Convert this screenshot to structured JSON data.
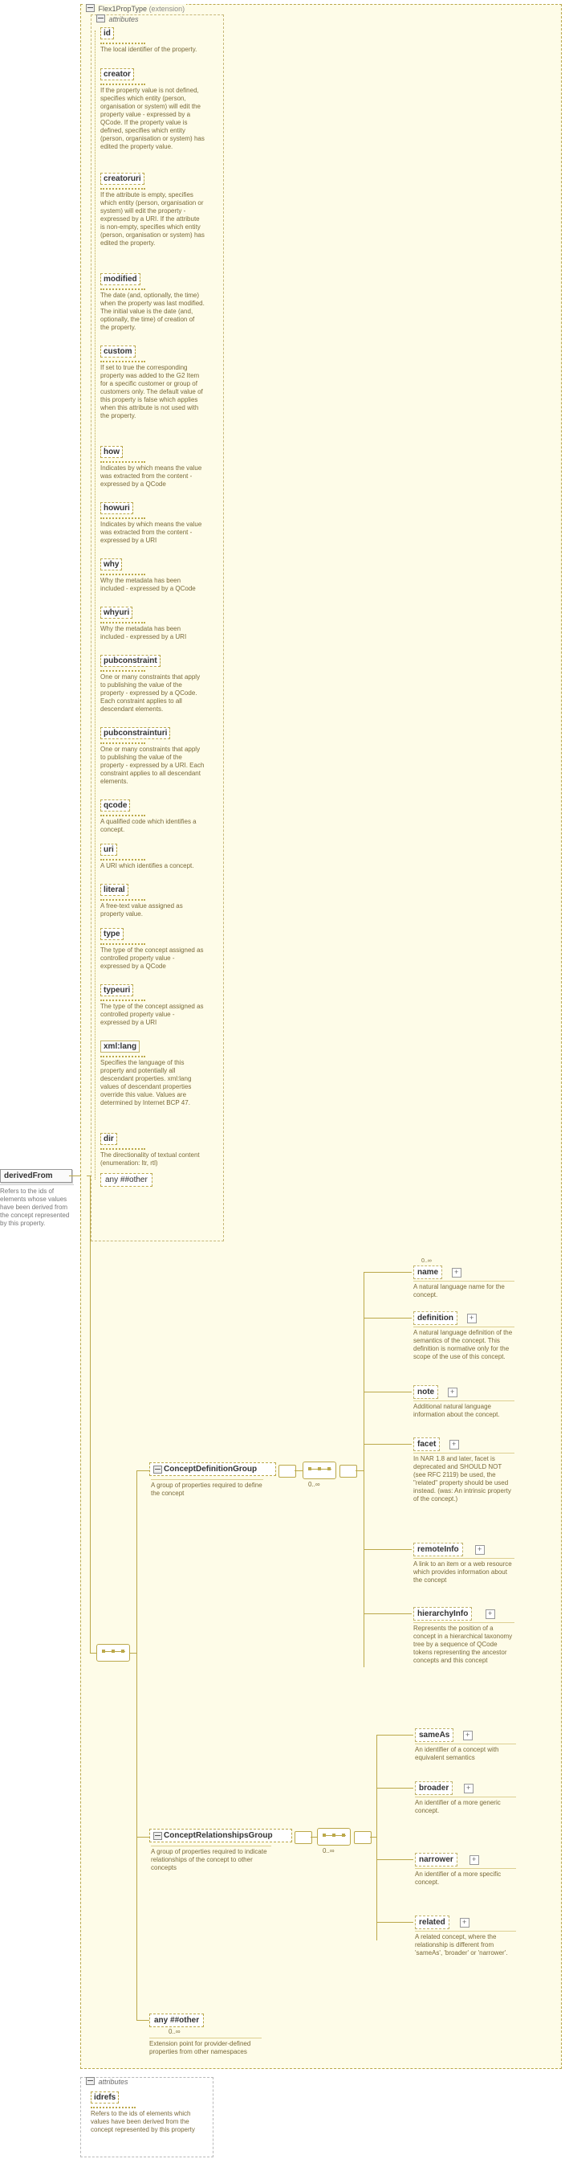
{
  "root": {
    "name": "derivedFrom",
    "desc": "Refers to the ids of elements whose values have been derived from the concept represented by this property."
  },
  "top_panel": {
    "label_type": "Flex1PropType",
    "label_ext": "(extension)"
  },
  "attr_group_top": {
    "label": "attributes",
    "items": [
      {
        "name": "id",
        "desc": "The local identifier of the property."
      },
      {
        "name": "creator",
        "desc": "If the property value is not defined, specifies which entity (person, organisation or system) will edit the property value - expressed by a QCode. If the property value is defined, specifies which entity (person, organisation or system) has edited the property value."
      },
      {
        "name": "creatoruri",
        "desc": "If the attribute is empty, specifies which entity (person, organisation or system) will edit the property - expressed by a URI. If the attribute is non-empty, specifies which entity (person, organisation or system) has edited the property."
      },
      {
        "name": "modified",
        "desc": "The date (and, optionally, the time) when the property was last modified. The initial value is the date (and, optionally, the time) of creation of the property."
      },
      {
        "name": "custom",
        "desc": "If set to true the corresponding property was added to the G2 Item for a specific customer or group of customers only. The default value of this property is false which applies when this attribute is not used with the property."
      },
      {
        "name": "how",
        "desc": "Indicates by which means the value was extracted from the content - expressed by a QCode"
      },
      {
        "name": "howuri",
        "desc": "Indicates by which means the value was extracted from the content - expressed by a URI"
      },
      {
        "name": "why",
        "desc": "Why the metadata has been included - expressed by a QCode"
      },
      {
        "name": "whyuri",
        "desc": "Why the metadata has been included - expressed by a URI"
      },
      {
        "name": "pubconstraint",
        "desc": "One or many constraints that apply to publishing the value of the property - expressed by a QCode. Each constraint applies to all descendant elements."
      },
      {
        "name": "pubconstrainturi",
        "desc": "One or many constraints that apply to publishing the value of the property - expressed by a URI. Each constraint applies to all descendant elements."
      },
      {
        "name": "qcode",
        "desc": "A qualified code which identifies a concept."
      },
      {
        "name": "uri",
        "desc": "A URI which identifies a concept."
      },
      {
        "name": "literal",
        "desc": "A free-text value assigned as property value."
      },
      {
        "name": "type",
        "desc": "The type of the concept assigned as controlled property value - expressed by a QCode"
      },
      {
        "name": "typeuri",
        "desc": "The type of the concept assigned as controlled property value - expressed by a URI"
      },
      {
        "name": "xml:lang",
        "desc": "Specifies the language of this property and potentially all descendant properties. xml:lang values of descendant properties override this value. Values are determined by Internet BCP 47."
      },
      {
        "name": "dir",
        "desc": "The directionality of textual content (enumeration: ltr, rtl)"
      }
    ],
    "any_other": "any ##other"
  },
  "groups": {
    "def": {
      "label": "ConceptDefinitionGroup",
      "desc": "A group of properties required to define the concept"
    },
    "rel": {
      "label": "ConceptRelationshipsGroup",
      "desc": "A group of properties required to indicate relationships of the concept to other concepts"
    }
  },
  "def_children": {
    "name": {
      "label": "name",
      "desc": "A natural language name for the concept."
    },
    "definition": {
      "label": "definition",
      "desc": "A natural language definition of the semantics of the concept. This definition is normative only for the scope of the use of this concept."
    },
    "note": {
      "label": "note",
      "desc": "Additional natural language information about the concept."
    },
    "facet": {
      "label": "facet",
      "desc": "In NAR 1.8 and later, facet is deprecated and SHOULD NOT (see RFC 2119) be used, the \"related\" property should be used instead. (was: An intrinsic property of the concept.)"
    },
    "remoteInfo": {
      "label": "remoteInfo",
      "desc": "A link to an item or a web resource which provides information about the concept"
    },
    "hierarchyInfo": {
      "label": "hierarchyInfo",
      "desc": "Represents the position of a concept in a hierarchical taxonomy tree by a sequence of QCode tokens representing the ancestor concepts and this concept"
    }
  },
  "rel_children": {
    "sameAs": {
      "label": "sameAs",
      "desc": "An identifier of a concept with equivalent semantics"
    },
    "broader": {
      "label": "broader",
      "desc": "An identifier of a more generic concept."
    },
    "narrower": {
      "label": "narrower",
      "desc": "An identifier of a more specific concept."
    },
    "related": {
      "label": "related",
      "desc": "A related concept, where the relationship is different from 'sameAs', 'broader' or 'narrower'."
    }
  },
  "any_bottom": {
    "label": "any ##other",
    "occ": "0..∞",
    "desc": "Extension point for provider-defined properties from other namespaces"
  },
  "attr_group_bottom": {
    "label": "attributes",
    "idrefs": {
      "name": "idrefs",
      "desc": "Refers to the ids of elements which values have been derived from the concept represented by this property"
    }
  },
  "occ": "0..∞"
}
